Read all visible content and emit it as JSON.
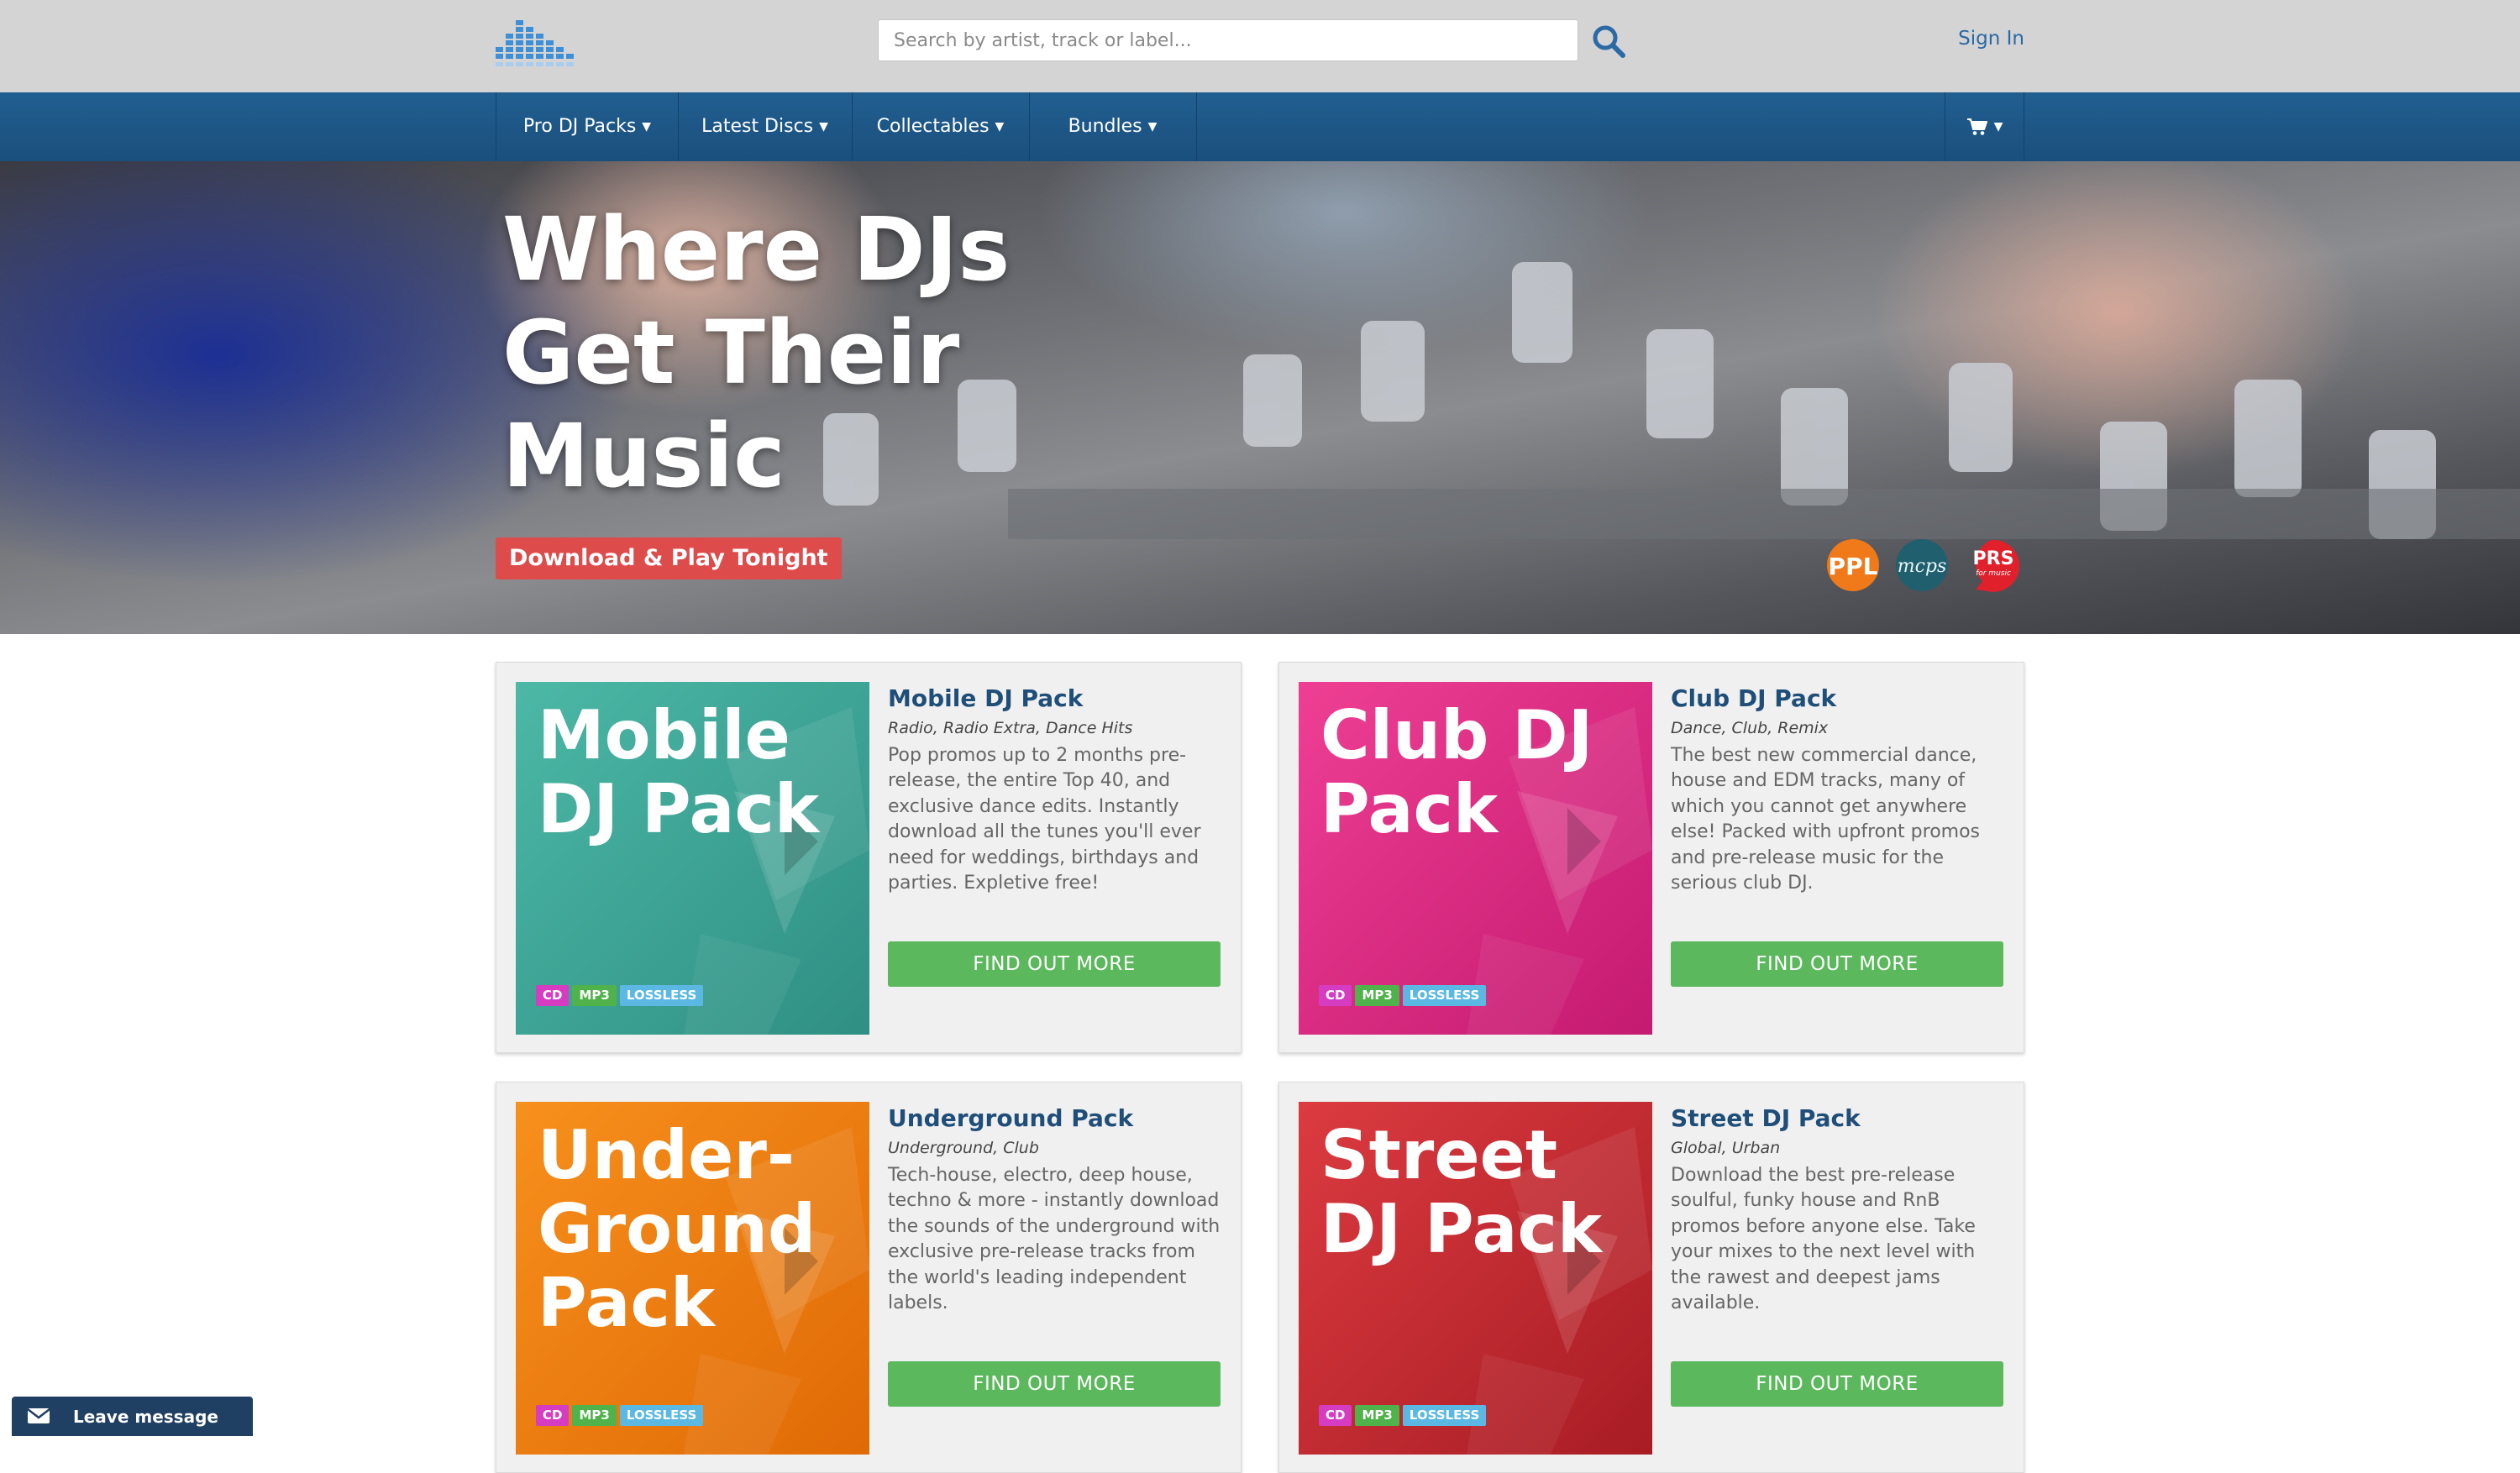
{
  "header": {
    "search": {
      "placeholder": "Search by artist, track or label...",
      "value": ""
    },
    "sign_in": "Sign In"
  },
  "nav": {
    "items": [
      {
        "label": "Pro DJ Packs"
      },
      {
        "label": "Latest Discs"
      },
      {
        "label": "Collectables"
      },
      {
        "label": "Bundles"
      }
    ]
  },
  "hero": {
    "title": "Where DJs Get Their Music",
    "cta": "Download & Play Tonight",
    "logos": [
      "PPL",
      "mcps",
      "PRS",
      "for music"
    ]
  },
  "formats": {
    "cd": "CD",
    "mp3": "MP3",
    "lossless": "LOSSLESS"
  },
  "colors": {
    "nav": "#215f91",
    "find_button": "#5cb85c",
    "cta": "#dd4b4b",
    "title": "#1f4e79"
  },
  "cards": [
    {
      "art_title": "Mobile DJ Pack",
      "title": "Mobile DJ Pack",
      "genres": "Radio, Radio Extra, Dance Hits",
      "description": "Pop promos up to 2 months pre-release, the entire Top 40, and exclusive dance edits. Instantly download all the tunes you'll ever need for weddings, birthdays and parties. Expletive free!",
      "button": "FIND OUT MORE",
      "color": "#3aa697"
    },
    {
      "art_title": "Club DJ Pack",
      "title": "Club DJ Pack",
      "genres": "Dance, Club, Remix",
      "description": "The best new commercial dance, house and EDM tracks, many of which you cannot get anywhere else! Packed with upfront promos and pre-release music for the serious club DJ.",
      "button": "FIND OUT MORE",
      "color": "#e0237f"
    },
    {
      "art_title": "Under-Ground Pack",
      "title": "Underground Pack",
      "genres": "Underground, Club",
      "description": "Tech-house, electro, deep house, techno & more - instantly download the sounds of the underground with exclusive pre-release tracks from the world's leading independent labels.",
      "button": "FIND OUT MORE",
      "color": "#f07a10"
    },
    {
      "art_title": "Street DJ Pack",
      "title": "Street DJ Pack",
      "genres": "Global, Urban",
      "description": "Download the best pre-release soulful, funky house and RnB promos before anyone else. Take your mixes to the next level with the rawest and deepest jams available.",
      "button": "FIND OUT MORE",
      "color": "#c8262f"
    }
  ],
  "chat": {
    "label": "Leave message"
  }
}
